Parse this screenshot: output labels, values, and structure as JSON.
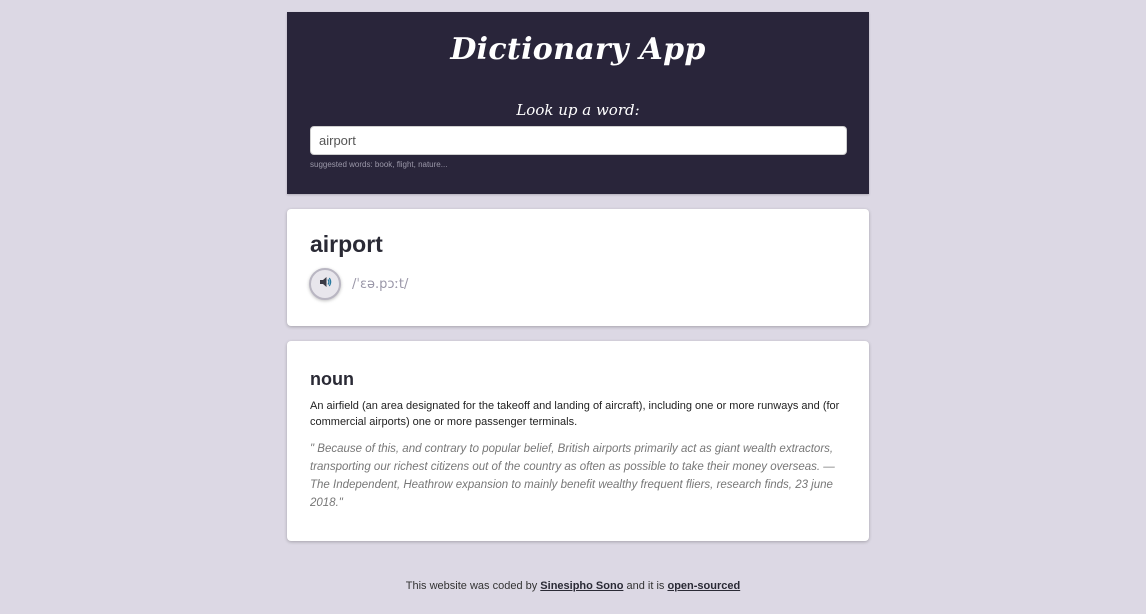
{
  "header": {
    "title": "Dictionary App",
    "lookup_label": "Look up a word:",
    "search": {
      "value": "airport",
      "placeholder": ""
    },
    "suggested": "suggested words: book, flight, nature..."
  },
  "word_card": {
    "word": "airport",
    "audio_icon": "speaker-icon",
    "phonetic": "/ˈɛə.pɔːt/"
  },
  "meanings": [
    {
      "part_of_speech": "noun",
      "definition": "An airfield (an area designated for the takeoff and landing of aircraft), including one or more runways and (for commercial airports) one or more passenger terminals.",
      "example": "\" Because of this, and contrary to popular belief, British airports primarily act as giant wealth extractors, transporting our richest citizens out of the country as often as possible to take their money overseas. — The Independent, Heathrow expansion to mainly benefit wealthy frequent fliers, research finds, 23 june 2018.\""
    }
  ],
  "footer": {
    "prefix": "This website was coded by",
    "author_link": "Sinesipho Sono",
    "middle": "and it is",
    "source_link": "open-sourced"
  },
  "colors": {
    "page_background": "#dcd8e4",
    "header_background": "#29253a",
    "muted_text": "#9a97a8"
  }
}
